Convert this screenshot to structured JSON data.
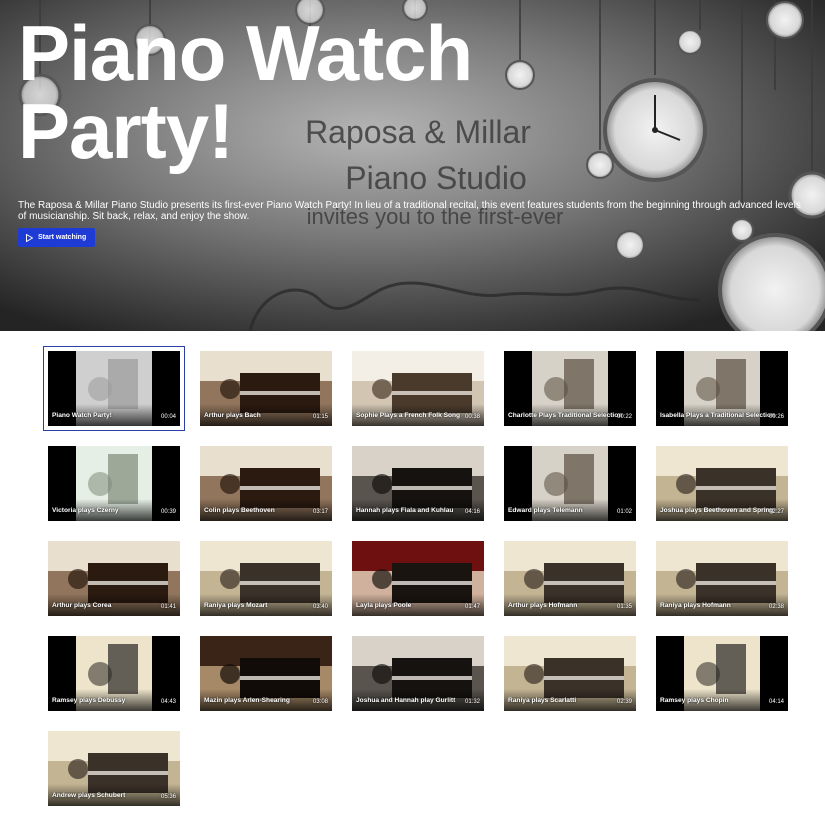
{
  "hero": {
    "title": "Piano Watch Party!",
    "background_text_line1": "Raposa & Millar",
    "background_text_line2": "Piano Studio",
    "background_text_line3": "invites you to the first-ever",
    "description": "The Raposa & Millar Piano Studio presents its first-ever Piano Watch Party! In lieu of a traditional recital, this event features students from the beginning through advanced levels of musicianship. Sit back, relax, and enjoy the show.",
    "start_button_label": "Start watching",
    "accent_color": "#1f3bd6"
  },
  "videos": [
    {
      "title": "Piano Watch Party!",
      "duration": "00:04",
      "selected": true,
      "theme": "clocks"
    },
    {
      "title": "Arthur plays Bach",
      "duration": "01:15",
      "theme": "piano-brown"
    },
    {
      "title": "Sophie Plays a French Folk Song",
      "duration": "00:38",
      "theme": "piano-light"
    },
    {
      "title": "Charlotte Plays Traditional Selection",
      "duration": "00:22",
      "theme": "portrait"
    },
    {
      "title": "Isabella Plays a Traditional Selection",
      "duration": "00:26",
      "theme": "portrait"
    },
    {
      "title": "Victoria plays Czerny",
      "duration": "00:39",
      "theme": "portrait-light"
    },
    {
      "title": "Colin plays Beethoven",
      "duration": "03:17",
      "theme": "piano-brown"
    },
    {
      "title": "Hannah plays Fiala and Kuhlau",
      "duration": "04:16",
      "theme": "piano-dark"
    },
    {
      "title": "Edward plays Telemann",
      "duration": "01:02",
      "theme": "portrait"
    },
    {
      "title": "Joshua plays Beethoven and Spring",
      "duration": "02:27",
      "theme": "room-light"
    },
    {
      "title": "Arthur plays Corea",
      "duration": "01:41",
      "theme": "piano-brown"
    },
    {
      "title": "Raniya plays Mozart",
      "duration": "03:40",
      "theme": "room-light"
    },
    {
      "title": "Layla plays Poole",
      "duration": "01:47",
      "theme": "red-curtain"
    },
    {
      "title": "Arthur plays Hofmann",
      "duration": "01:35",
      "theme": "room-light"
    },
    {
      "title": "Raniya plays Hofmann",
      "duration": "02:38",
      "theme": "room-light"
    },
    {
      "title": "Ramsey plays Debussy",
      "duration": "04:43",
      "theme": "portrait-cream"
    },
    {
      "title": "Mazin plays Arlen-Shearing",
      "duration": "03:08",
      "theme": "room-dark"
    },
    {
      "title": "Joshua and Hannah play Gurlitt",
      "duration": "01:32",
      "theme": "piano-dark"
    },
    {
      "title": "Raniya plays Scarlatti",
      "duration": "02:39",
      "theme": "room-light"
    },
    {
      "title": "Ramsey plays Chopin",
      "duration": "04:14",
      "theme": "portrait-cream"
    },
    {
      "title": "Andrew plays Schubert",
      "duration": "05:36",
      "theme": "room-light"
    }
  ]
}
